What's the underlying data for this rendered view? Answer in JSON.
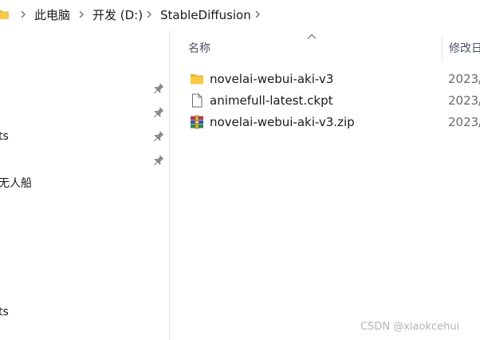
{
  "address_bar": {
    "crumbs": [
      "此电脑",
      "开发 (D:)",
      "StableDiffusion"
    ]
  },
  "nav_pane": {
    "items": [
      {
        "label": "",
        "pinned": true
      },
      {
        "label": "",
        "pinned": true
      },
      {
        "label": "ts",
        "pinned": true
      },
      {
        "label": "",
        "pinned": true
      },
      {
        "label": "无人船",
        "pinned": false
      },
      {
        "label": "ts",
        "pinned": false
      }
    ]
  },
  "columns": {
    "name": "名称",
    "modified": "修改日"
  },
  "files": [
    {
      "name": "novelai-webui-aki-v3",
      "type": "folder",
      "date": "2023/"
    },
    {
      "name": "animefull-latest.ckpt",
      "type": "file",
      "date": "2023/"
    },
    {
      "name": "novelai-webui-aki-v3.zip",
      "type": "archive",
      "date": "2023/"
    }
  ],
  "watermark": "CSDN @xiaokcehui",
  "colors": {
    "folder_yellow": "#f8c945",
    "text": "#1a1a1a",
    "header_text": "#4b5563",
    "divider": "#e5e5e5"
  }
}
